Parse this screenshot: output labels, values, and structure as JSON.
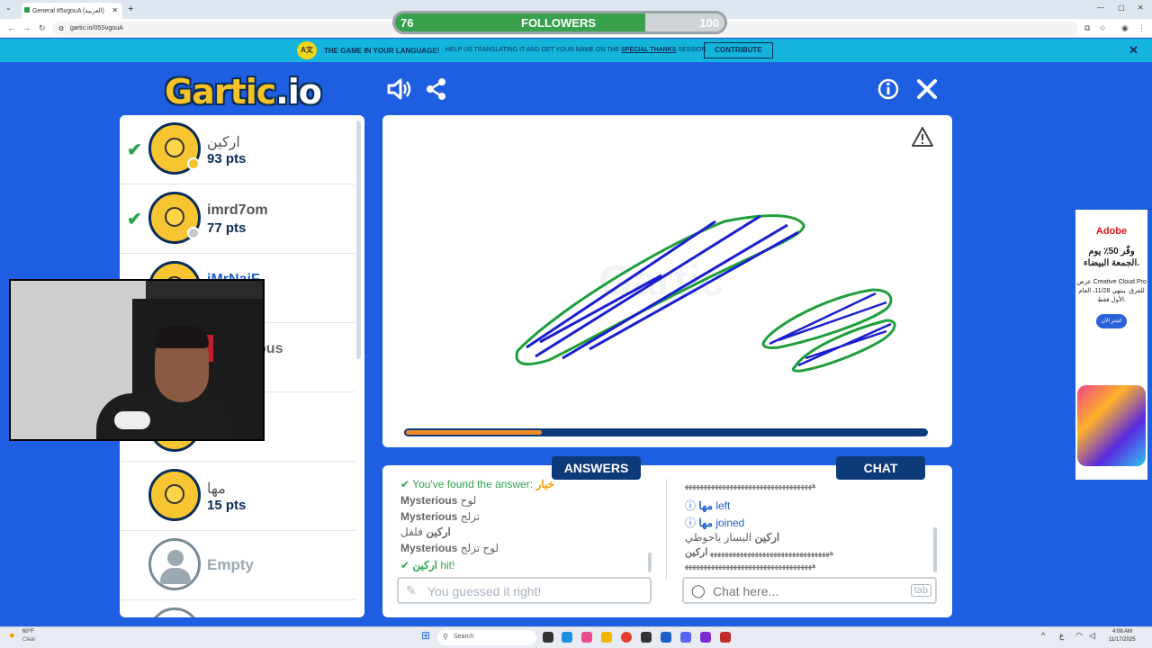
{
  "browser": {
    "tab_title": "General #5vgouA (العربية)",
    "url": "gartic.io/05SvgouA"
  },
  "followers": {
    "label": "FOLLOWERS",
    "current": "76",
    "goal": "100",
    "progress_fraction": 0.76
  },
  "banner": {
    "headline": "THE GAME IN YOUR LANGUAGE!",
    "text_before": "HELP US TRANSLATING IT AND GET YOUR NAME ON THE ",
    "text_link": "SPECIAL THANKS",
    "text_after": " SESSION",
    "contribute": "CONTRIBUTE"
  },
  "logo": {
    "main": "Gartic",
    "suffix": ".io"
  },
  "players": [
    {
      "name": "اركين",
      "points": "93 pts",
      "found": true,
      "dot": "#f5c227"
    },
    {
      "name": "imrd7om",
      "points": "77 pts",
      "found": true,
      "dot": "#c4c9cd"
    },
    {
      "name": "iMrNaiF",
      "points": "",
      "found": false
    },
    {
      "name": "Mysterious",
      "points": "",
      "found": false
    },
    {
      "name": "",
      "points": "",
      "found": false
    },
    {
      "name": "مها",
      "points": "15 pts",
      "found": false
    },
    {
      "name": "Empty",
      "points": "",
      "found": false,
      "empty": true
    }
  ],
  "drawing": {
    "timer_fraction": 0.26
  },
  "answers": {
    "tab": "ANSWERS",
    "found_prefix": "You've found the answer: ",
    "found_word": "خيار",
    "lines": [
      {
        "user": "Mysterious",
        "text": "لوح"
      },
      {
        "user": "Mysterious",
        "text": "تزلج"
      },
      {
        "user": "اركين",
        "text": "فلفل"
      },
      {
        "user": "Mysterious",
        "text": "لوح تزلج"
      }
    ],
    "hit_user": "اركين",
    "hit_text": "hit!",
    "input_placeholder": "You guessed it right!"
  },
  "chat": {
    "tab": "CHAT",
    "lines": [
      {
        "type": "spam",
        "text": "ﻫﻬﻬﻬﻬﻬﻬﻬﻬﻬﻬﻬﻬﻬﻬﻬﻬﻬﻬﻬﻬﻬﻬﻬﻬﻬﻬﻬﻬﻬﻬﻬﻬﻬﻬ"
      },
      {
        "type": "info",
        "user": "مها",
        "text": "left"
      },
      {
        "type": "info",
        "user": "مها",
        "text": "joined"
      },
      {
        "type": "msg",
        "user": "اركين",
        "text": "اليسار ياحوطي"
      },
      {
        "type": "msg",
        "user": "اركين",
        "text": "ﻫﻬﻬﻬﻬﻬﻬﻬﻬﻬﻬﻬﻬﻬﻬﻬﻬﻬﻬﻬﻬﻬﻬﻬﻬﻬﻬﻬﻬﻬﻬﻬﻬ"
      },
      {
        "type": "spam",
        "text": "ﻫﻬﻬﻬﻬﻬﻬﻬﻬﻬﻬﻬﻬﻬﻬﻬﻬﻬﻬﻬﻬﻬﻬﻬﻬﻬﻬﻬﻬﻬﻬﻬﻬﻬﻬ"
      }
    ],
    "input_placeholder": "Chat here...",
    "tab_key": "tab"
  },
  "ad": {
    "brand": "Adobe",
    "headline": "وفّر 50٪ يوم الجمعة البيضاء.",
    "body": "عرض Creative Cloud Pro للفرق. ينتهي 11/28، العام الأول فقط.",
    "cta": "اشتر الآن"
  },
  "taskbar": {
    "weather_temp": "60°F",
    "weather_text": "Clear",
    "search": "Search",
    "time": "4:08 AM",
    "date": "11/17/2025"
  }
}
